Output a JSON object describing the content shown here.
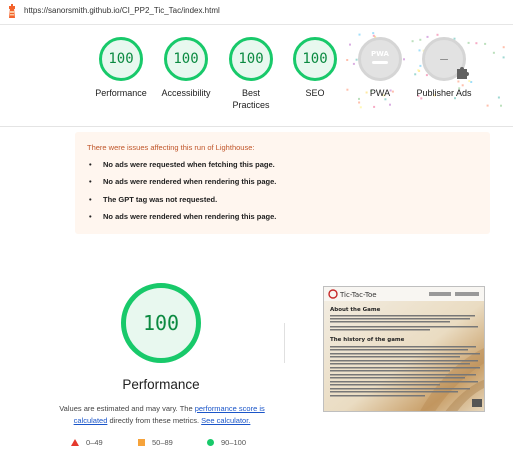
{
  "url": "https://sanorsmith.github.io/CI_PP2_Tic_Tac/index.html",
  "gauges": [
    {
      "score": "100",
      "label": "Performance"
    },
    {
      "score": "100",
      "label": "Accessibility"
    },
    {
      "score": "100",
      "label": "Best Practices"
    },
    {
      "score": "100",
      "label": "SEO"
    },
    {
      "score": "PWA",
      "label": "PWA"
    },
    {
      "score": "–",
      "label": "Publisher Ads"
    }
  ],
  "warning": {
    "title": "There were issues affecting this run of Lighthouse:",
    "items": [
      "No ads were requested when fetching this page.",
      "No ads were rendered when rendering this page.",
      "The GPT tag was not requested.",
      "No ads were rendered when rendering this page."
    ]
  },
  "main": {
    "score": "100",
    "title": "Performance",
    "desc_before": "Values are estimated and may vary. The ",
    "desc_link1": "performance score is calculated",
    "desc_middle": " directly from these metrics. ",
    "desc_link2": "See calculator."
  },
  "legend": [
    {
      "range": "0–49",
      "color": "#e4392d",
      "shape": "triangle"
    },
    {
      "range": "50–89",
      "color": "#f6a33b",
      "shape": "square"
    },
    {
      "range": "90–100",
      "color": "#18c96a",
      "shape": "circle"
    }
  ],
  "screenshot": {
    "brand": "Tic-Tac-Toe",
    "heading1": "About the Game",
    "heading2": "The history of the game"
  }
}
